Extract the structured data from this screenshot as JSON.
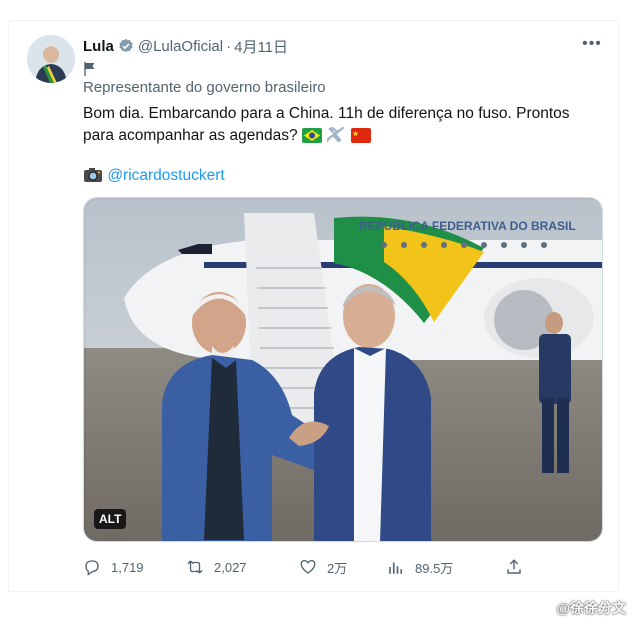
{
  "tweet": {
    "name": "Lula",
    "handle": "@LulaOficial",
    "separator": "·",
    "date": "4月11日",
    "more_label": "•••",
    "affiliation_label": "Representante do governo brasileiro",
    "text_line1": "Bom dia. Embarcando para a China. 11h de diferença no fuso. Prontos",
    "text_line2": "para acompanhar as agendas?",
    "mention": "@ricardostuckert",
    "alt_badge": "ALT",
    "plane_text": "REPÚBLICA FEDERATIVA DO BRASIL"
  },
  "actions": {
    "replies": "1,719",
    "retweets": "2,027",
    "likes": "2万",
    "views": "89.5万"
  },
  "watermark": "@徐徐分文",
  "colors": {
    "link": "#1d9bf0",
    "muted": "#536471",
    "verified_badge": "#829aab"
  }
}
